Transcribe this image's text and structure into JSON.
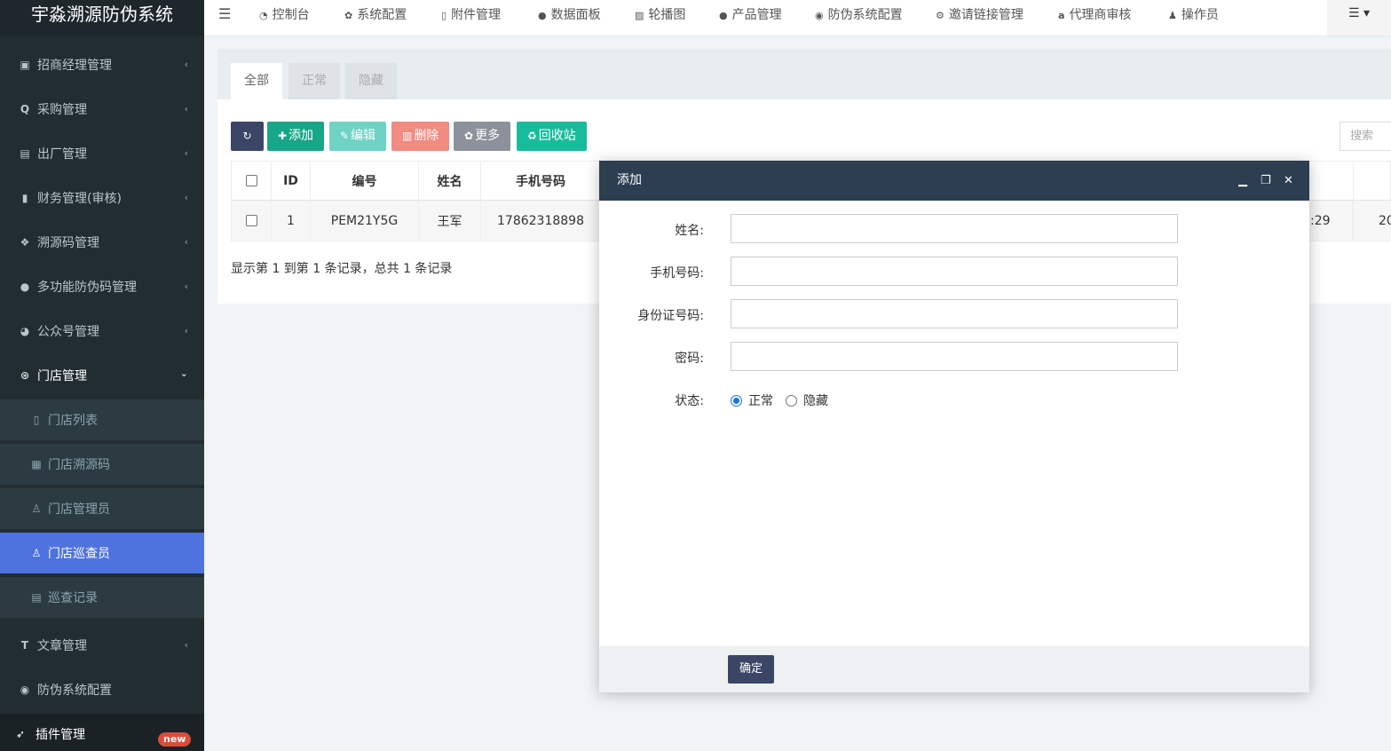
{
  "brand": "宇淼溯源防伪系统",
  "sidebar": {
    "items": [
      {
        "label": "招商经理管理",
        "icon": "id-card-icon"
      },
      {
        "label": "采购管理",
        "icon": "search-icon"
      },
      {
        "label": "出厂管理",
        "icon": "hdd-icon"
      },
      {
        "label": "财务管理(审核)",
        "icon": "book-icon"
      },
      {
        "label": "溯源码管理",
        "icon": "cubes-icon"
      },
      {
        "label": "多功能防伪码管理",
        "icon": "info-icon"
      },
      {
        "label": "公众号管理",
        "icon": "wechat-icon"
      },
      {
        "label": "门店管理",
        "icon": "gear-circle-icon"
      }
    ],
    "sub_items": [
      {
        "label": "门店列表",
        "icon": "list-icon"
      },
      {
        "label": "门店溯源码",
        "icon": "qrcode-icon"
      },
      {
        "label": "门店管理员",
        "icon": "person-icon"
      },
      {
        "label": "门店巡查员",
        "icon": "person-icon"
      },
      {
        "label": "巡查记录",
        "icon": "list-alt-icon"
      }
    ],
    "after_items": [
      {
        "label": "文章管理",
        "icon": "text-icon"
      },
      {
        "label": "防伪系统配置",
        "icon": "chrome-icon"
      }
    ],
    "bottom": {
      "label": "插件管理",
      "badge": "new",
      "icon": "rocket-icon"
    }
  },
  "topnav": {
    "items": [
      {
        "label": "控制台",
        "icon": "dashboard-icon"
      },
      {
        "label": "系统配置",
        "icon": "cog-icon"
      },
      {
        "label": "附件管理",
        "icon": "file-icon"
      },
      {
        "label": "数据面板",
        "icon": "globe-icon"
      },
      {
        "label": "轮播图",
        "icon": "image-icon"
      },
      {
        "label": "产品管理",
        "icon": "globe-icon"
      },
      {
        "label": "防伪系统配置",
        "icon": "chrome-icon"
      },
      {
        "label": "邀请链接管理",
        "icon": "cogs-icon"
      },
      {
        "label": "代理商审核",
        "icon": "amazon-icon"
      },
      {
        "label": "操作员",
        "icon": "user-icon"
      }
    ]
  },
  "tabs": [
    "全部",
    "正常",
    "隐藏"
  ],
  "toolbar": {
    "refresh_icon": "refresh-icon",
    "add": "添加",
    "edit": "编辑",
    "delete": "删除",
    "more": "更多",
    "recycle": "回收站",
    "search_placeholder": "搜索"
  },
  "table": {
    "headers": [
      "ID",
      "编号",
      "姓名",
      "手机号码"
    ],
    "row": {
      "id": "1",
      "code": "PEM21Y5G",
      "name": "王军",
      "phone": "17862318898",
      "partial_time": ":29",
      "partial_extra": "20"
    },
    "summary": "显示第 1 到第 1 条记录，总共 1 条记录"
  },
  "modal": {
    "title": "添加",
    "fields": [
      {
        "label": "姓名:",
        "value": ""
      },
      {
        "label": "手机号码:",
        "value": ""
      },
      {
        "label": "身份证号码:",
        "value": ""
      },
      {
        "label": "密码:",
        "value": ""
      }
    ],
    "status_label": "状态:",
    "status_options": [
      "正常",
      "隐藏"
    ],
    "status_selected": "正常",
    "confirm": "确定"
  },
  "colors": {
    "sidebar_bg": "#222d32",
    "active_bg": "#4e73df",
    "add_btn": "#18bc9c",
    "edit_btn": "#6ed3c5",
    "delete_btn": "#f28b82",
    "more_btn": "#95a5a6",
    "recycle_btn": "#18bc9c",
    "refresh_btn": "#3b4566",
    "modal_header": "#2c3e50"
  }
}
